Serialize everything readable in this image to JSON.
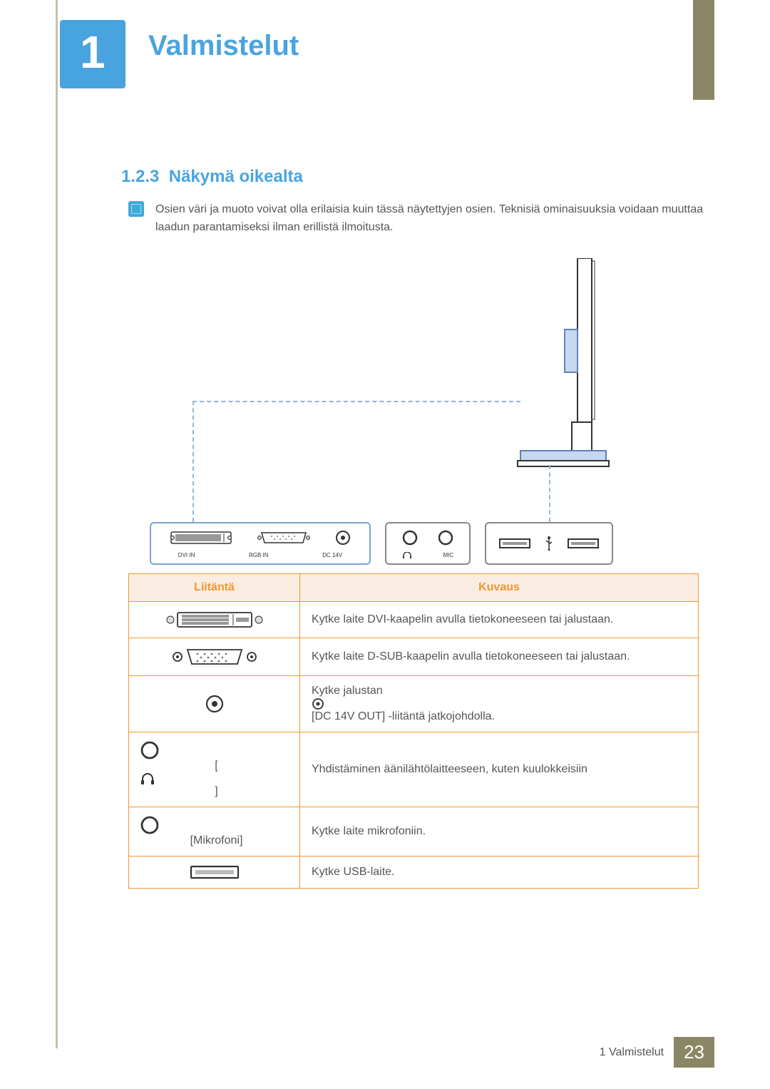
{
  "chapter": {
    "number": "1",
    "title": "Valmistelut"
  },
  "section": {
    "number": "1.2.3",
    "title": "Näkymä oikealta"
  },
  "note": "Osien väri ja muoto voivat olla erilaisia kuin tässä näytettyjen osien. Teknisiä ominaisuuksia voidaan muuttaa laadun parantamiseksi ilman erillistä ilmoitusta.",
  "diagram": {
    "ports_main": [
      {
        "label": "DVI IN"
      },
      {
        "label": "RGB IN"
      },
      {
        "label": "DC 14V"
      }
    ],
    "ports_side": [
      {
        "label": ""
      },
      {
        "label": "MIC"
      }
    ]
  },
  "table": {
    "headers": {
      "port": "Liitäntä",
      "description": "Kuvaus"
    },
    "rows": [
      {
        "icon": "dvi",
        "desc": "Kytke laite DVI-kaapelin avulla tietokoneeseen tai jalustaan."
      },
      {
        "icon": "vga",
        "desc": "Kytke laite D-SUB-kaapelin avulla tietokoneeseen tai jalustaan."
      },
      {
        "icon": "dc",
        "desc_pre": "Kytke jalustan ",
        "inline_label": "[DC 14V OUT]",
        "desc_post": " -liitäntä jatkojohdolla."
      },
      {
        "icon": "headphone",
        "bracket": "[",
        "bracket_close": "]",
        "desc": "Yhdistäminen äänilähtölaitteeseen, kuten kuulokkeisiin"
      },
      {
        "icon": "mic",
        "bracket_text": "[Mikrofoni]",
        "desc": "Kytke laite mikrofoniin."
      },
      {
        "icon": "usb",
        "desc": "Kytke USB-laite."
      }
    ]
  },
  "footer": {
    "text": "1 Valmistelut",
    "page": "23"
  }
}
